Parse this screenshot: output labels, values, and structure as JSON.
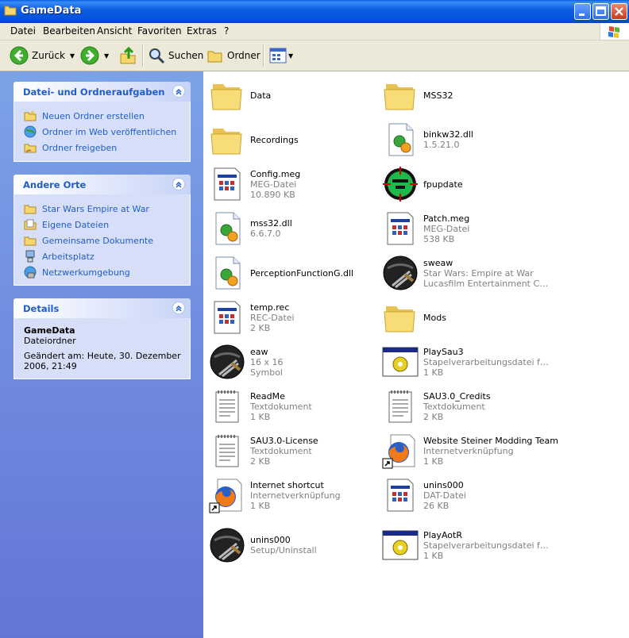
{
  "window": {
    "title": "GameData"
  },
  "menu": [
    "Datei",
    "Bearbeiten",
    "Ansicht",
    "Favoriten",
    "Extras",
    "?"
  ],
  "toolbar": {
    "back": "Zurück",
    "search": "Suchen",
    "folders": "Ordner"
  },
  "tasks": {
    "title": "Datei- und Ordneraufgaben",
    "items": [
      {
        "label": "Neuen Ordner erstellen",
        "icon": "new-folder-icon"
      },
      {
        "label": "Ordner im Web veröffentlichen",
        "icon": "publish-web-icon"
      },
      {
        "label": "Ordner freigeben",
        "icon": "share-folder-icon"
      }
    ]
  },
  "places": {
    "title": "Andere Orte",
    "items": [
      {
        "label": "Star Wars Empire at War",
        "icon": "folder-icon"
      },
      {
        "label": "Eigene Dateien",
        "icon": "my-documents-icon"
      },
      {
        "label": "Gemeinsame Dokumente",
        "icon": "folder-icon"
      },
      {
        "label": "Arbeitsplatz",
        "icon": "my-computer-icon"
      },
      {
        "label": "Netzwerkumgebung",
        "icon": "network-icon"
      }
    ]
  },
  "details": {
    "title": "Details",
    "name": "GameData",
    "type": "Dateiordner",
    "modified": "Geändert am: Heute, 30. Dezember 2006, 21:49"
  },
  "files": [
    {
      "name": "Data",
      "line2": "",
      "line3": "",
      "icon": "folder"
    },
    {
      "name": "MSS32",
      "line2": "",
      "line3": "",
      "icon": "folder"
    },
    {
      "name": "Recordings",
      "line2": "",
      "line3": "",
      "icon": "folder"
    },
    {
      "name": "binkw32.dll",
      "line2": "1.5.21.0",
      "line3": "",
      "icon": "dll"
    },
    {
      "name": "Config.meg",
      "line2": "MEG-Datei",
      "line3": "10.890 KB",
      "icon": "doc"
    },
    {
      "name": "fpupdate",
      "line2": "",
      "line3": "",
      "icon": "fpupdate"
    },
    {
      "name": "mss32.dll",
      "line2": "6.6.7.0",
      "line3": "",
      "icon": "dll"
    },
    {
      "name": "Patch.meg",
      "line2": "MEG-Datei",
      "line3": "538 KB",
      "icon": "doc"
    },
    {
      "name": "PerceptionFunctionG.dll",
      "line2": "",
      "line3": "",
      "icon": "dll"
    },
    {
      "name": "sweaw",
      "line2": "Star Wars: Empire at War",
      "line3": "Lucasfilm Entertainment Comp...",
      "icon": "tie"
    },
    {
      "name": "temp.rec",
      "line2": "REC-Datei",
      "line3": "2 KB",
      "icon": "doc"
    },
    {
      "name": "Mods",
      "line2": "",
      "line3": "",
      "icon": "folder"
    },
    {
      "name": "eaw",
      "line2": "16 x 16",
      "line3": "Symbol",
      "icon": "tie"
    },
    {
      "name": "PlaySau3",
      "line2": "Stapelverarbeitungsdatei für ...",
      "line3": "1 KB",
      "icon": "batch"
    },
    {
      "name": "ReadMe",
      "line2": "Textdokument",
      "line3": "1 KB",
      "icon": "text"
    },
    {
      "name": "SAU3.0_Credits",
      "line2": "Textdokument",
      "line3": "2 KB",
      "icon": "text"
    },
    {
      "name": "SAU3.0-License",
      "line2": "Textdokument",
      "line3": "2 KB",
      "icon": "text"
    },
    {
      "name": "Website Steiner Modding Team",
      "line2": "Internetverknüpfung",
      "line3": "1 KB",
      "icon": "firefox"
    },
    {
      "name": "Internet shortcut",
      "line2": "Internetverknüpfung",
      "line3": "1 KB",
      "icon": "firefox"
    },
    {
      "name": "unins000",
      "line2": "DAT-Datei",
      "line3": "26 KB",
      "icon": "doc"
    },
    {
      "name": "unins000",
      "line2": "Setup/Uninstall",
      "line3": "",
      "icon": "tie"
    },
    {
      "name": "PlayAotR",
      "line2": "Stapelverarbeitungsdatei für ...",
      "line3": "1 KB",
      "icon": "batch"
    }
  ]
}
